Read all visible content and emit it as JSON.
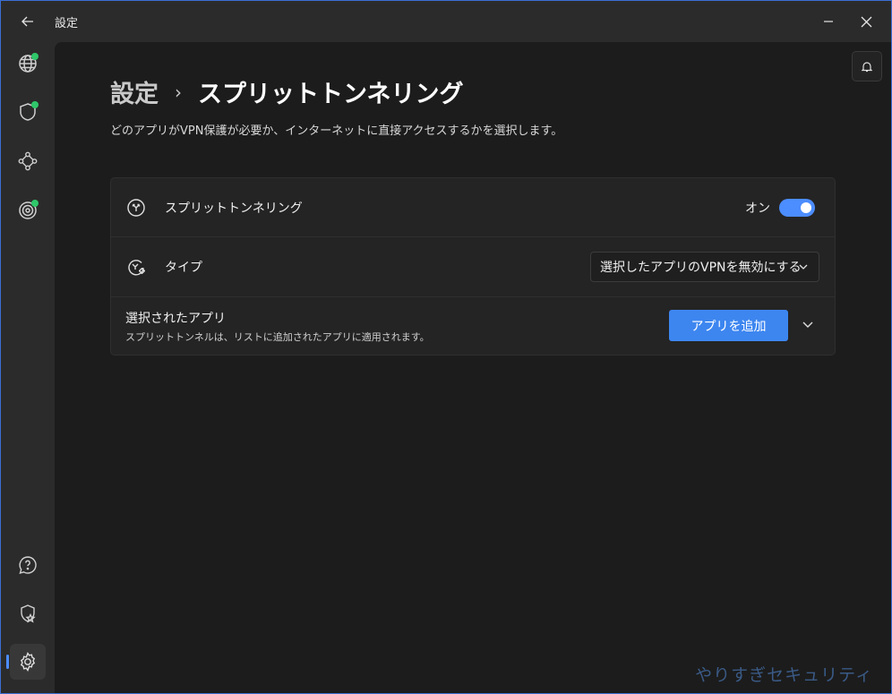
{
  "window": {
    "title": "設定",
    "back_icon": "back-arrow-icon",
    "minimize_icon": "minimize-icon",
    "close_icon": "close-icon",
    "border_color": "#3b6fd4"
  },
  "sidebar": {
    "items": [
      {
        "name": "globe",
        "icon": "globe-icon",
        "status": "connected"
      },
      {
        "name": "shield",
        "icon": "shield-icon",
        "status": "connected"
      },
      {
        "name": "meshnet",
        "icon": "network-nodes-icon"
      },
      {
        "name": "threat-protection",
        "icon": "target-icon",
        "status": "connected"
      },
      {
        "name": "help",
        "icon": "help-bubble-icon"
      },
      {
        "name": "rewards",
        "icon": "badge-star-icon"
      },
      {
        "name": "settings",
        "icon": "gear-icon",
        "active": true
      }
    ],
    "status_color": "#2fc76a",
    "active_color": "#4c8dff"
  },
  "header": {
    "breadcrumb_root": "設定",
    "breadcrumb_sep": "›",
    "breadcrumb_current": "スプリットトンネリング",
    "subtitle": "どのアプリがVPN保護が必要か、インターネットに直接アクセスするかを選択します。",
    "notification_icon": "bell-icon"
  },
  "settings": {
    "split_tunneling": {
      "label": "スプリットトンネリング",
      "icon": "split-arrows-icon",
      "toggle_text": "オン",
      "enabled": true
    },
    "type": {
      "label": "タイプ",
      "icon": "split-gear-icon",
      "selected": "選択したアプリのVPNを無効にする"
    },
    "selected_apps": {
      "title": "選択されたアプリ",
      "description": "スプリットトンネルは、リストに追加されたアプリに適用されます。",
      "add_button": "アプリを追加"
    }
  },
  "accent_color": "#3d86f0",
  "watermark": "やりすぎセキュリティ"
}
